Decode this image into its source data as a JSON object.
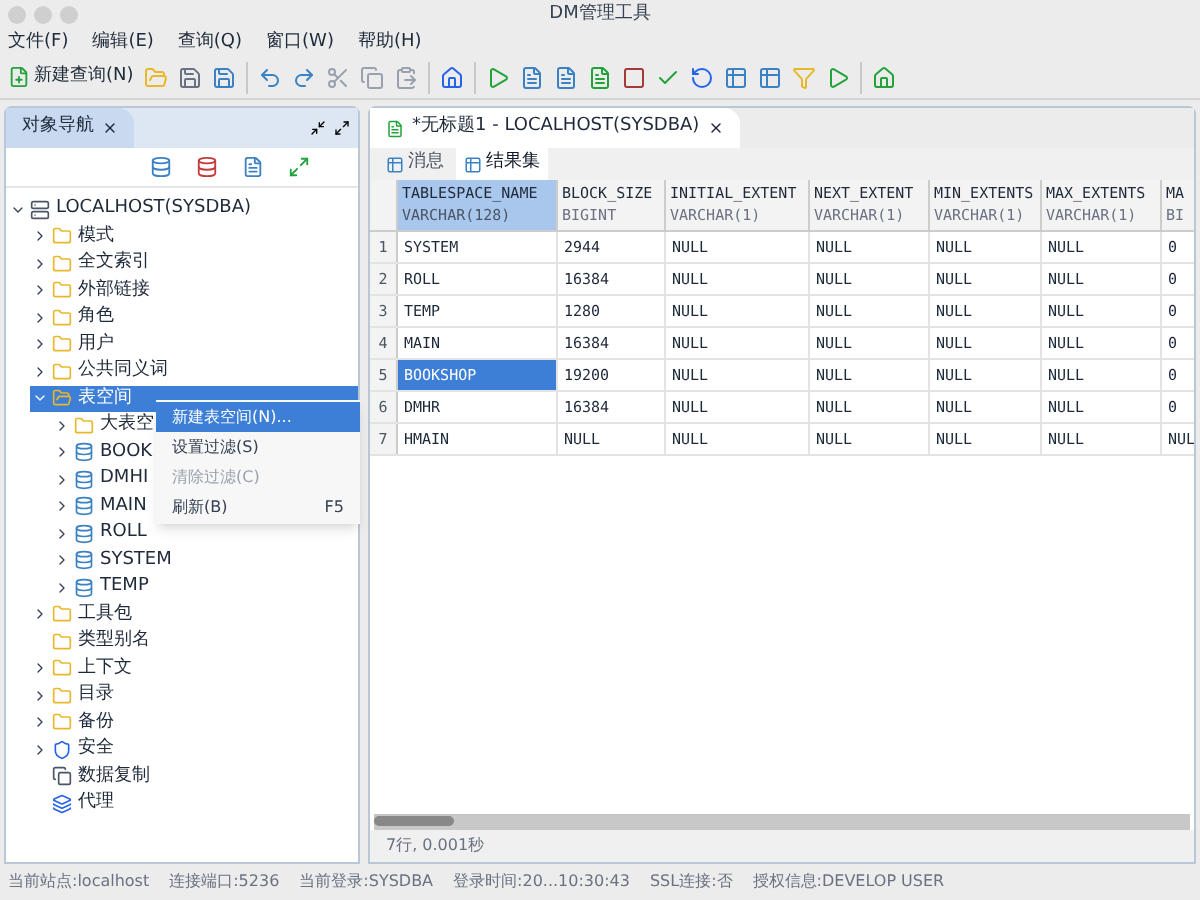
{
  "window": {
    "title": "DM管理工具"
  },
  "menu": [
    "文件(F)",
    "编辑(E)",
    "查询(Q)",
    "窗口(W)",
    "帮助(H)"
  ],
  "toolbar": {
    "new_query": "新建查询(N)"
  },
  "navigator": {
    "tab": "对象导航",
    "tree": [
      {
        "label": "LOCALHOST(SYSDBA)",
        "kind": "server",
        "expandable": true,
        "expanded": true,
        "selected": false,
        "children": [
          {
            "label": "模式",
            "kind": "folder",
            "expandable": true,
            "expanded": false,
            "selected": false
          },
          {
            "label": "全文索引",
            "kind": "folder",
            "expandable": true,
            "expanded": false,
            "selected": false
          },
          {
            "label": "外部链接",
            "kind": "folder",
            "expandable": true,
            "expanded": false,
            "selected": false
          },
          {
            "label": "角色",
            "kind": "folder",
            "expandable": true,
            "expanded": false,
            "selected": false
          },
          {
            "label": "用户",
            "kind": "folder",
            "expandable": true,
            "expanded": false,
            "selected": false
          },
          {
            "label": "公共同义词",
            "kind": "folder",
            "expandable": true,
            "expanded": false,
            "selected": false
          },
          {
            "label": "表空间",
            "kind": "folder",
            "expandable": true,
            "expanded": true,
            "selected": true,
            "children": [
              {
                "label": "大表空",
                "kind": "folder",
                "expandable": true,
                "expanded": false,
                "selected": false
              },
              {
                "label": "BOOK",
                "kind": "tablespace",
                "expandable": true,
                "expanded": false,
                "selected": false
              },
              {
                "label": "DMHI",
                "kind": "tablespace",
                "expandable": true,
                "expanded": false,
                "selected": false
              },
              {
                "label": "MAIN",
                "kind": "tablespace",
                "expandable": true,
                "expanded": false,
                "selected": false
              },
              {
                "label": "ROLL",
                "kind": "tablespace",
                "expandable": true,
                "expanded": false,
                "selected": false
              },
              {
                "label": "SYSTEM",
                "kind": "tablespace",
                "expandable": true,
                "expanded": false,
                "selected": false
              },
              {
                "label": "TEMP",
                "kind": "tablespace",
                "expandable": true,
                "expanded": false,
                "selected": false
              }
            ]
          },
          {
            "label": "工具包",
            "kind": "folder",
            "expandable": true,
            "expanded": false,
            "selected": false
          },
          {
            "label": "类型别名",
            "kind": "folder",
            "expandable": false,
            "expanded": false,
            "selected": false
          },
          {
            "label": "上下文",
            "kind": "folder",
            "expandable": true,
            "expanded": false,
            "selected": false
          },
          {
            "label": "目录",
            "kind": "folder",
            "expandable": true,
            "expanded": false,
            "selected": false
          },
          {
            "label": "备份",
            "kind": "folder",
            "expandable": true,
            "expanded": false,
            "selected": false
          },
          {
            "label": "安全",
            "kind": "shield",
            "expandable": true,
            "expanded": false,
            "selected": false
          },
          {
            "label": "数据复制",
            "kind": "replication",
            "expandable": false,
            "expanded": false,
            "selected": false
          },
          {
            "label": "代理",
            "kind": "agent",
            "expandable": false,
            "expanded": false,
            "selected": false
          }
        ]
      }
    ]
  },
  "context_menu": [
    {
      "label": "新建表空间(N)...",
      "disabled": false,
      "selected": true
    },
    {
      "label": "设置过滤(S)",
      "disabled": false,
      "selected": false
    },
    {
      "label": "清除过滤(C)",
      "disabled": true,
      "selected": false
    },
    {
      "label": "刷新(B)",
      "shortcut": "F5",
      "disabled": false,
      "selected": false
    }
  ],
  "editor": {
    "tab": "*无标题1 - LOCALHOST(SYSDBA)",
    "result_tabs": [
      {
        "label": "消息",
        "selected": false
      },
      {
        "label": "结果集",
        "selected": true
      }
    ],
    "table": {
      "columns": [
        {
          "name": "TABLESPACE_NAME",
          "type": "VARCHAR(128)"
        },
        {
          "name": "BLOCK_SIZE",
          "type": "BIGINT"
        },
        {
          "name": "INITIAL_EXTENT",
          "type": "VARCHAR(1)"
        },
        {
          "name": "NEXT_EXTENT",
          "type": "VARCHAR(1)"
        },
        {
          "name": "MIN_EXTENTS",
          "type": "VARCHAR(1)"
        },
        {
          "name": "MAX_EXTENTS",
          "type": "VARCHAR(1)"
        },
        {
          "name": "MA",
          "type": "BI"
        }
      ],
      "rows": [
        {
          "num": "1",
          "selected": false,
          "cells": [
            "SYSTEM",
            "2944",
            "NULL",
            "NULL",
            "NULL",
            "NULL",
            "0"
          ]
        },
        {
          "num": "2",
          "selected": false,
          "cells": [
            "ROLL",
            "16384",
            "NULL",
            "NULL",
            "NULL",
            "NULL",
            "0"
          ]
        },
        {
          "num": "3",
          "selected": false,
          "cells": [
            "TEMP",
            "1280",
            "NULL",
            "NULL",
            "NULL",
            "NULL",
            "0"
          ]
        },
        {
          "num": "4",
          "selected": false,
          "cells": [
            "MAIN",
            "16384",
            "NULL",
            "NULL",
            "NULL",
            "NULL",
            "0"
          ]
        },
        {
          "num": "5",
          "selected": true,
          "cells": [
            "BOOKSHOP",
            "19200",
            "NULL",
            "NULL",
            "NULL",
            "NULL",
            "0"
          ]
        },
        {
          "num": "6",
          "selected": false,
          "cells": [
            "DMHR",
            "16384",
            "NULL",
            "NULL",
            "NULL",
            "NULL",
            "0"
          ]
        },
        {
          "num": "7",
          "selected": false,
          "cells": [
            "HMAIN",
            "NULL",
            "NULL",
            "NULL",
            "NULL",
            "NULL",
            "NUL"
          ]
        }
      ]
    },
    "summary": "7行, 0.001秒"
  },
  "status_bar": [
    "当前站点:localhost",
    "连接端口:5236",
    "当前登录:SYSDBA",
    "登录时间:20...10:30:43",
    "SSL连接:否",
    "授权信息:DEVELOP USER"
  ]
}
